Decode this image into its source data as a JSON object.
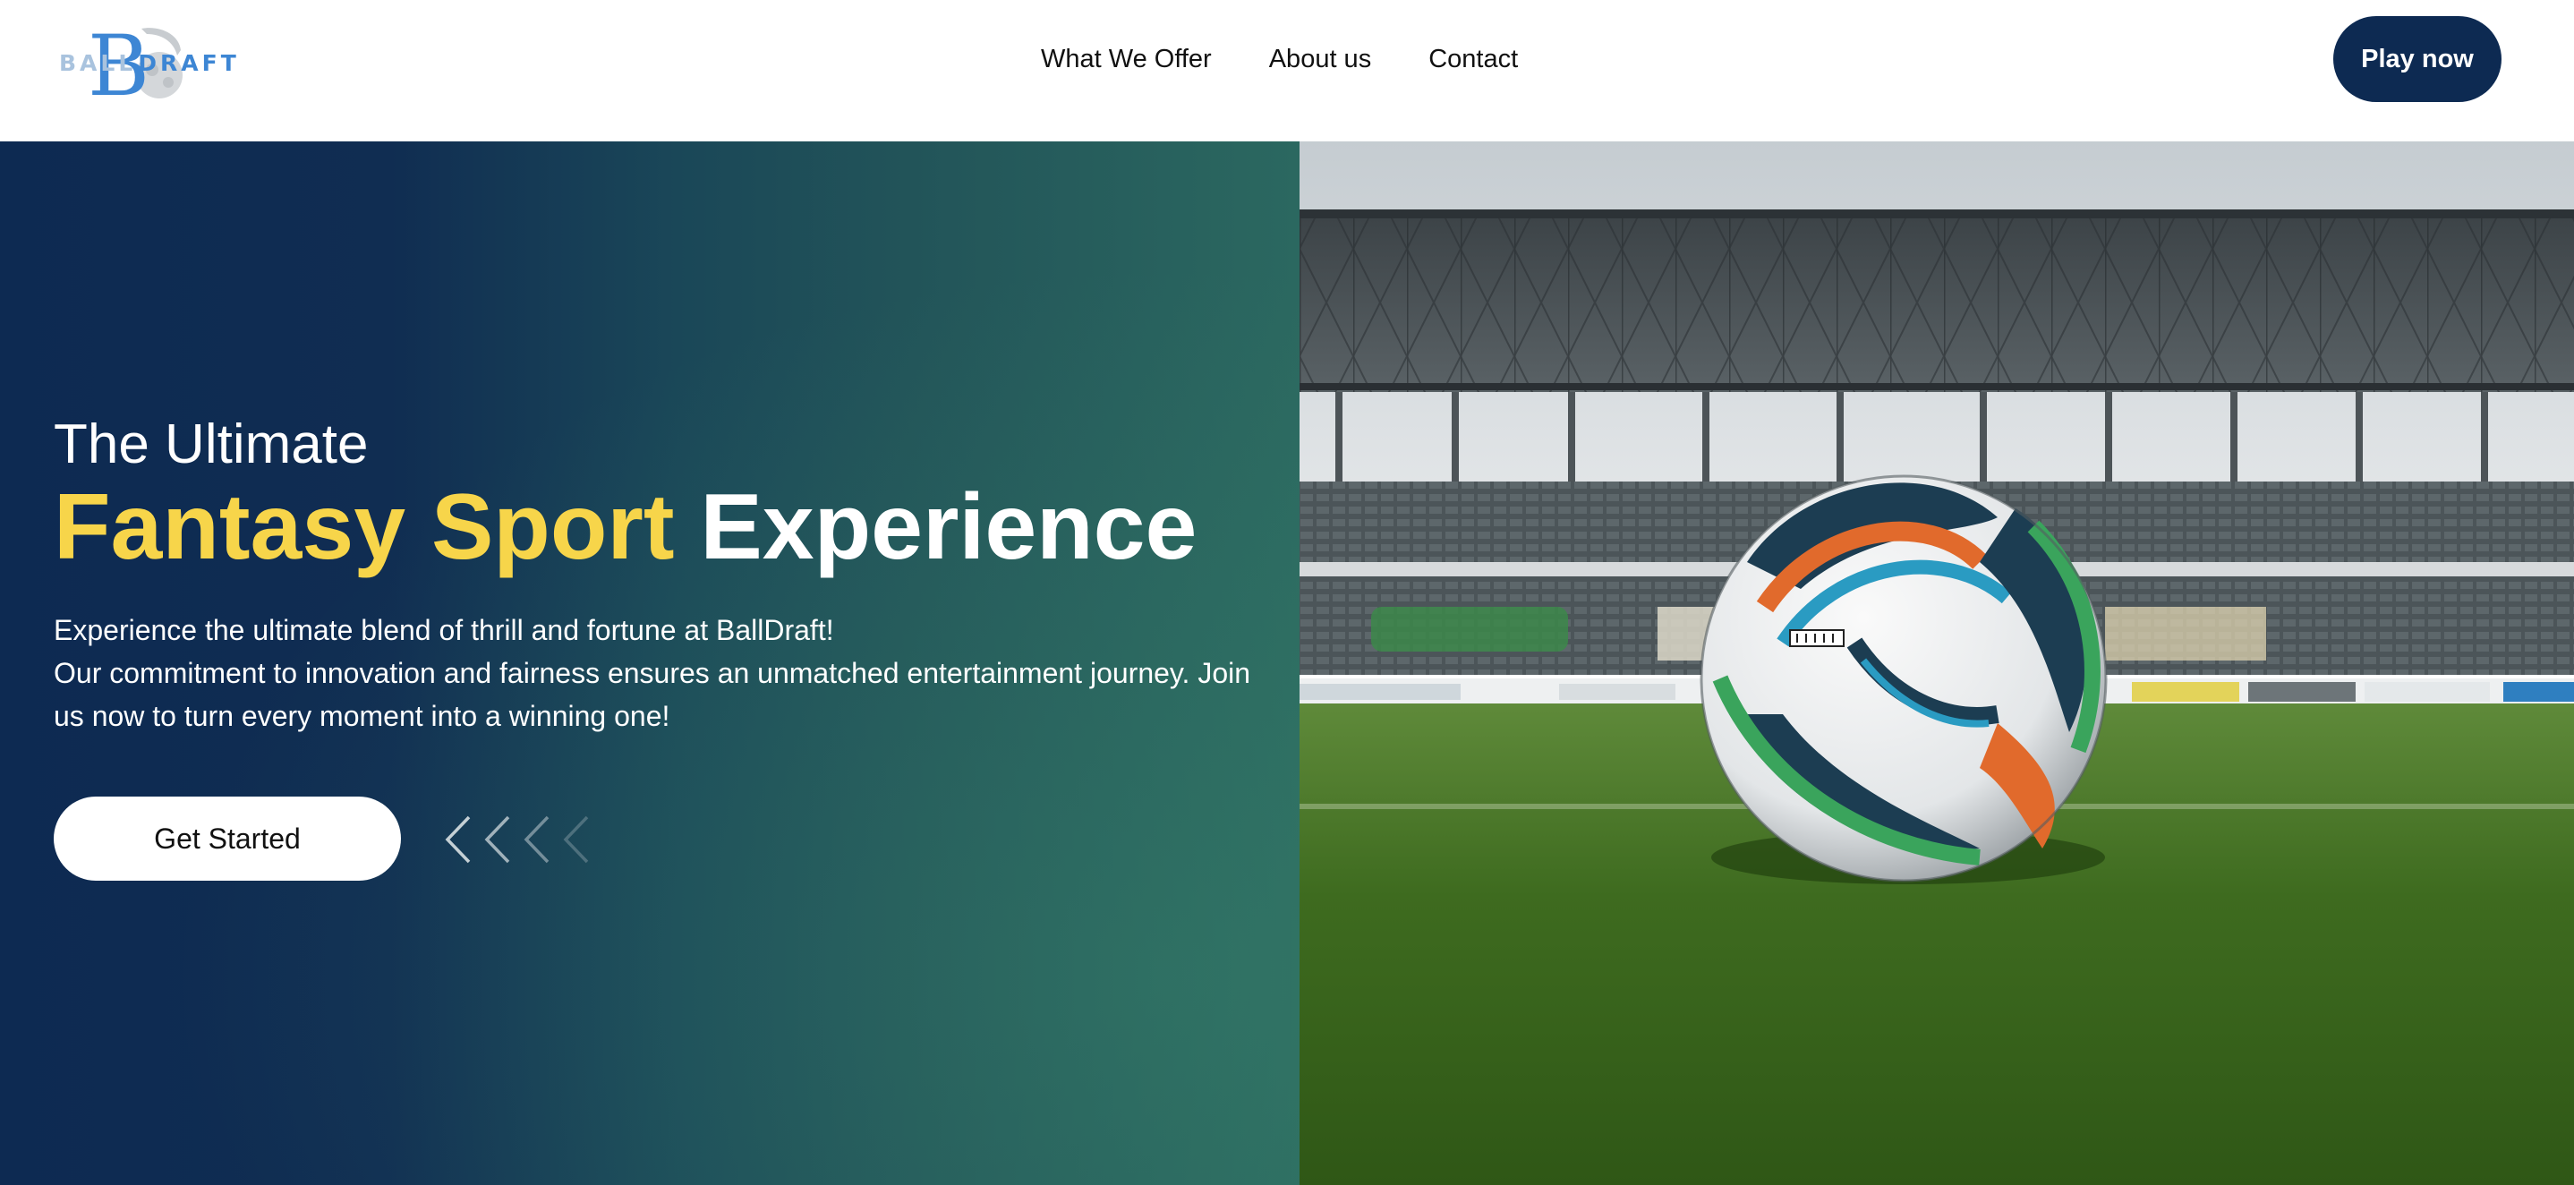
{
  "brand": {
    "logo_letter": "B",
    "logo_text_light": "BALL",
    "logo_text_accent": "DRAFT",
    "logo_icon": "balldraft-logo-icon"
  },
  "nav": {
    "items": [
      {
        "label": "What We Offer"
      },
      {
        "label": "About us"
      },
      {
        "label": "Contact"
      }
    ],
    "cta_label": "Play now"
  },
  "hero": {
    "tagline": "The Ultimate",
    "headline_highlight": "Fantasy Sport",
    "headline_rest": "Experience",
    "description_line1": "Experience the ultimate blend of thrill and fortune at BallDraft!",
    "description_line2": "Our commitment to innovation and fairness ensures an unmatched entertainment journey. Join us now to turn every moment into a winning one!",
    "cta_label": "Get Started",
    "decor_icon": "chevrons-left-icon",
    "image_icon": "stadium-soccer-ball-photo"
  },
  "colors": {
    "navy": "#0d2a52",
    "teal": "#2b6860",
    "accent_yellow": "#f7d54a",
    "logo_blue": "#3d86d4",
    "white": "#ffffff"
  }
}
